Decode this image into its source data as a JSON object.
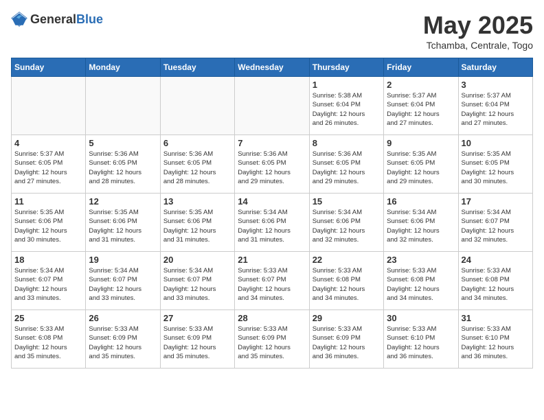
{
  "header": {
    "logo_general": "General",
    "logo_blue": "Blue",
    "title": "May 2025",
    "subtitle": "Tchamba, Centrale, Togo"
  },
  "days_of_week": [
    "Sunday",
    "Monday",
    "Tuesday",
    "Wednesday",
    "Thursday",
    "Friday",
    "Saturday"
  ],
  "weeks": [
    [
      {
        "day": "",
        "info": ""
      },
      {
        "day": "",
        "info": ""
      },
      {
        "day": "",
        "info": ""
      },
      {
        "day": "",
        "info": ""
      },
      {
        "day": "1",
        "info": "Sunrise: 5:38 AM\nSunset: 6:04 PM\nDaylight: 12 hours\nand 26 minutes."
      },
      {
        "day": "2",
        "info": "Sunrise: 5:37 AM\nSunset: 6:04 PM\nDaylight: 12 hours\nand 27 minutes."
      },
      {
        "day": "3",
        "info": "Sunrise: 5:37 AM\nSunset: 6:04 PM\nDaylight: 12 hours\nand 27 minutes."
      }
    ],
    [
      {
        "day": "4",
        "info": "Sunrise: 5:37 AM\nSunset: 6:05 PM\nDaylight: 12 hours\nand 27 minutes."
      },
      {
        "day": "5",
        "info": "Sunrise: 5:36 AM\nSunset: 6:05 PM\nDaylight: 12 hours\nand 28 minutes."
      },
      {
        "day": "6",
        "info": "Sunrise: 5:36 AM\nSunset: 6:05 PM\nDaylight: 12 hours\nand 28 minutes."
      },
      {
        "day": "7",
        "info": "Sunrise: 5:36 AM\nSunset: 6:05 PM\nDaylight: 12 hours\nand 29 minutes."
      },
      {
        "day": "8",
        "info": "Sunrise: 5:36 AM\nSunset: 6:05 PM\nDaylight: 12 hours\nand 29 minutes."
      },
      {
        "day": "9",
        "info": "Sunrise: 5:35 AM\nSunset: 6:05 PM\nDaylight: 12 hours\nand 29 minutes."
      },
      {
        "day": "10",
        "info": "Sunrise: 5:35 AM\nSunset: 6:05 PM\nDaylight: 12 hours\nand 30 minutes."
      }
    ],
    [
      {
        "day": "11",
        "info": "Sunrise: 5:35 AM\nSunset: 6:06 PM\nDaylight: 12 hours\nand 30 minutes."
      },
      {
        "day": "12",
        "info": "Sunrise: 5:35 AM\nSunset: 6:06 PM\nDaylight: 12 hours\nand 31 minutes."
      },
      {
        "day": "13",
        "info": "Sunrise: 5:35 AM\nSunset: 6:06 PM\nDaylight: 12 hours\nand 31 minutes."
      },
      {
        "day": "14",
        "info": "Sunrise: 5:34 AM\nSunset: 6:06 PM\nDaylight: 12 hours\nand 31 minutes."
      },
      {
        "day": "15",
        "info": "Sunrise: 5:34 AM\nSunset: 6:06 PM\nDaylight: 12 hours\nand 32 minutes."
      },
      {
        "day": "16",
        "info": "Sunrise: 5:34 AM\nSunset: 6:06 PM\nDaylight: 12 hours\nand 32 minutes."
      },
      {
        "day": "17",
        "info": "Sunrise: 5:34 AM\nSunset: 6:07 PM\nDaylight: 12 hours\nand 32 minutes."
      }
    ],
    [
      {
        "day": "18",
        "info": "Sunrise: 5:34 AM\nSunset: 6:07 PM\nDaylight: 12 hours\nand 33 minutes."
      },
      {
        "day": "19",
        "info": "Sunrise: 5:34 AM\nSunset: 6:07 PM\nDaylight: 12 hours\nand 33 minutes."
      },
      {
        "day": "20",
        "info": "Sunrise: 5:34 AM\nSunset: 6:07 PM\nDaylight: 12 hours\nand 33 minutes."
      },
      {
        "day": "21",
        "info": "Sunrise: 5:33 AM\nSunset: 6:07 PM\nDaylight: 12 hours\nand 34 minutes."
      },
      {
        "day": "22",
        "info": "Sunrise: 5:33 AM\nSunset: 6:08 PM\nDaylight: 12 hours\nand 34 minutes."
      },
      {
        "day": "23",
        "info": "Sunrise: 5:33 AM\nSunset: 6:08 PM\nDaylight: 12 hours\nand 34 minutes."
      },
      {
        "day": "24",
        "info": "Sunrise: 5:33 AM\nSunset: 6:08 PM\nDaylight: 12 hours\nand 34 minutes."
      }
    ],
    [
      {
        "day": "25",
        "info": "Sunrise: 5:33 AM\nSunset: 6:08 PM\nDaylight: 12 hours\nand 35 minutes."
      },
      {
        "day": "26",
        "info": "Sunrise: 5:33 AM\nSunset: 6:09 PM\nDaylight: 12 hours\nand 35 minutes."
      },
      {
        "day": "27",
        "info": "Sunrise: 5:33 AM\nSunset: 6:09 PM\nDaylight: 12 hours\nand 35 minutes."
      },
      {
        "day": "28",
        "info": "Sunrise: 5:33 AM\nSunset: 6:09 PM\nDaylight: 12 hours\nand 35 minutes."
      },
      {
        "day": "29",
        "info": "Sunrise: 5:33 AM\nSunset: 6:09 PM\nDaylight: 12 hours\nand 36 minutes."
      },
      {
        "day": "30",
        "info": "Sunrise: 5:33 AM\nSunset: 6:10 PM\nDaylight: 12 hours\nand 36 minutes."
      },
      {
        "day": "31",
        "info": "Sunrise: 5:33 AM\nSunset: 6:10 PM\nDaylight: 12 hours\nand 36 minutes."
      }
    ]
  ]
}
